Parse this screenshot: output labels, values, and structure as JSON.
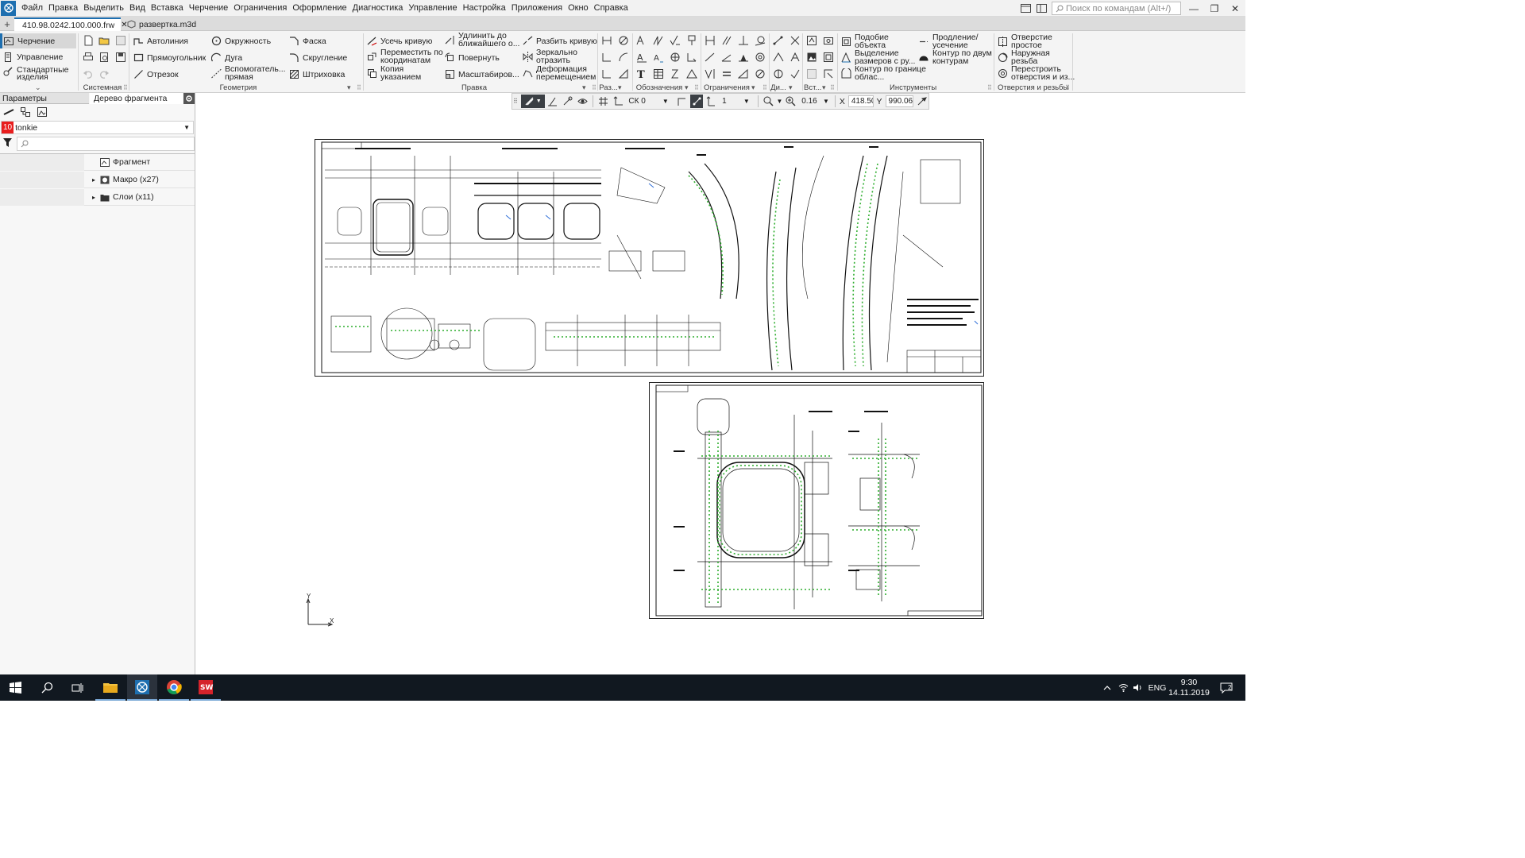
{
  "menu": [
    "Файл",
    "Правка",
    "Выделить",
    "Вид",
    "Вставка",
    "Черчение",
    "Ограничения",
    "Оформление",
    "Диагностика",
    "Управление",
    "Настройка",
    "Приложения",
    "Окно",
    "Справка"
  ],
  "command_search": {
    "placeholder": "Поиск по командам (Alt+/)"
  },
  "tabs": [
    {
      "label": "410.98.0242.100.000.frw",
      "active": true
    },
    {
      "label": "развертка.m3d",
      "active": false
    }
  ],
  "modes": [
    "Черчение",
    "Управление",
    "Стандартные изделия"
  ],
  "ribbon": {
    "groups": [
      "Системная",
      "Геометрия",
      "Правка",
      "Раз...",
      "Обозначения",
      "Ограничения",
      "Ди...",
      "Вст...",
      "Инструменты",
      "Отверстия и резьбы"
    ],
    "geometry": [
      "Автолиния",
      "Окружность",
      "Фаска",
      "Прямоугольник",
      "Дуга",
      "Скругление",
      "Отрезок",
      "Вспомогатель... прямая",
      "Штриховка"
    ],
    "edit": [
      "Усечь кривую",
      "Удлинить до ближайшего о...",
      "Разбить кривую",
      "Переместить по координатам",
      "Повернуть",
      "Зеркально отразить",
      "Копия указанием",
      "Масштабиров...",
      "Деформация перемещением"
    ],
    "tools": [
      "Подобие объекта",
      "Продление/ усечение",
      "Выделение размеров с ру...",
      "Контур по двум контурам",
      "Контур по границе облас..."
    ],
    "holes": [
      "Отверстие простое",
      "Наружная резьба",
      "Перестроить отверстия и из..."
    ]
  },
  "left_panel": {
    "tabs": [
      "Параметры",
      "Дерево фрагмента"
    ],
    "layer_number": "10",
    "layer_name": "tonkie",
    "search_placeholder": "",
    "tree": [
      {
        "label": "Фрагмент",
        "icon": "fragment-icon"
      },
      {
        "label": "Макро (x27)",
        "icon": "macro-icon"
      },
      {
        "label": "Слои (x11)",
        "icon": "layers-icon"
      }
    ]
  },
  "view_toolbar": {
    "cs": "СК 0",
    "step": "1",
    "zoom": "0.16",
    "x_label": "X",
    "x_value": "418.50",
    "y_label": "Y",
    "y_value": "990.06"
  },
  "axes": {
    "x": "X",
    "y": "Y"
  },
  "taskbar": {
    "lang": "ENG",
    "time": "9:30",
    "date": "14.11.2019",
    "notifications": "2"
  }
}
